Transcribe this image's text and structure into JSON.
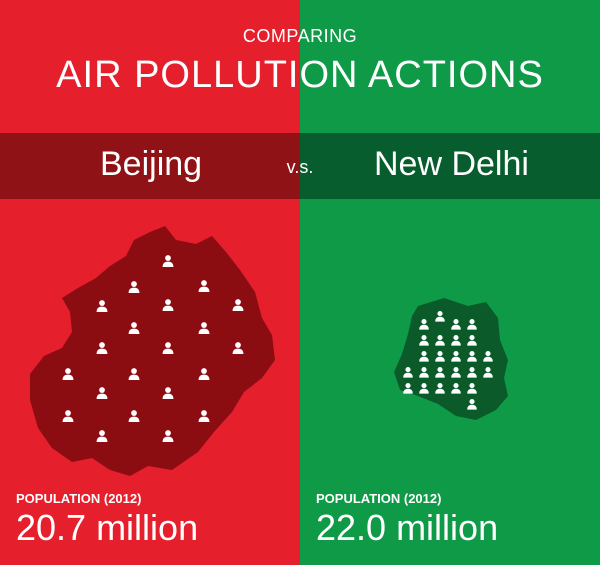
{
  "header": {
    "kicker": "COMPARING",
    "title": "AIR POLLUTION ACTIONS"
  },
  "comparison": {
    "left_city": "Beijing",
    "vs": "v.s.",
    "right_city": "New Delhi"
  },
  "left": {
    "population_label": "POPULATION (2012)",
    "population_value": "20.7 million",
    "map_color": "#8b0d12",
    "panel_color": "#e51f2c"
  },
  "right": {
    "population_label": "POPULATION (2012)",
    "population_value": "22.0 million",
    "map_color": "#0a5a2a",
    "panel_color": "#0f9a48"
  },
  "icons": {
    "person": "person-icon"
  }
}
